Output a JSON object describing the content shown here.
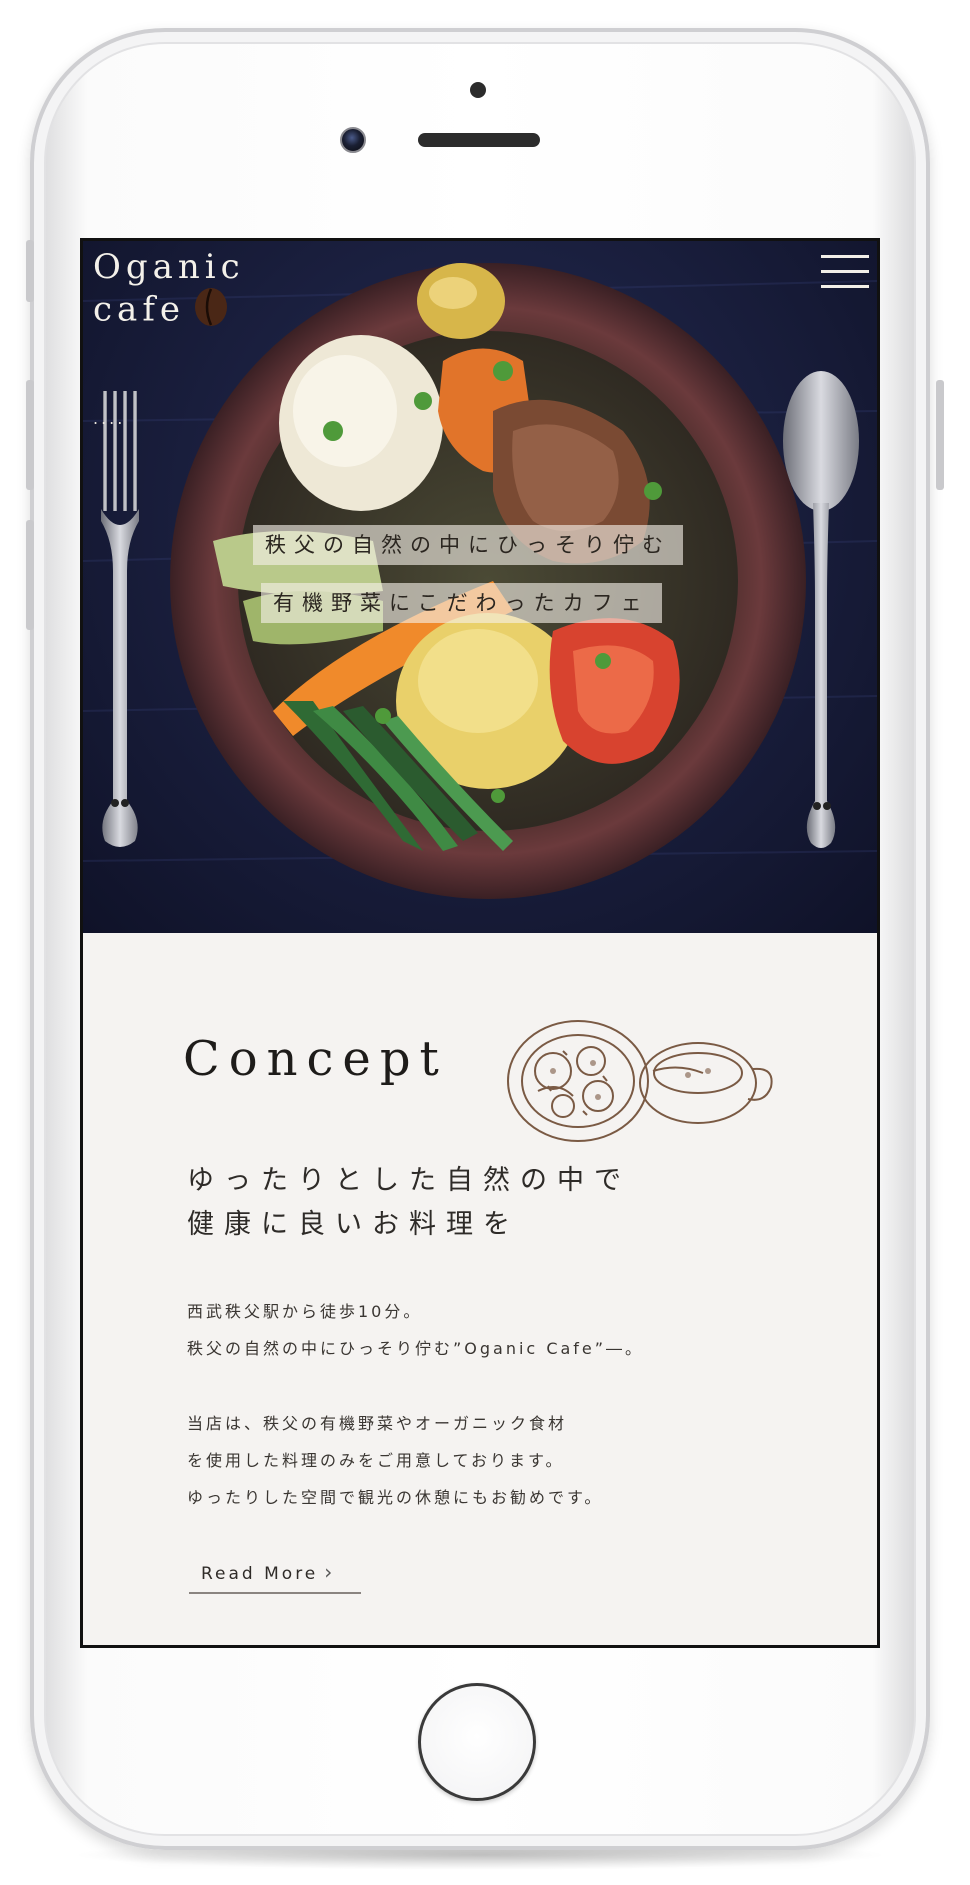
{
  "header": {
    "logo_line1": "Oganic",
    "logo_line2": "cafe",
    "menu_icon": "hamburger-menu-icon",
    "dots": "...."
  },
  "hero": {
    "tagline1": "秩父の自然の中にひっそり佇む",
    "tagline2": "有機野菜にこだわったカフェ"
  },
  "concept": {
    "title": "Concept",
    "lead_line1": "ゆったりとした自然の中で",
    "lead_line2": "健康に良いお料理を",
    "para1_line1": "西武秩父駅から徒歩10分。",
    "para1_line2": "秩父の自然の中にひっそり佇む”Oganic Cafe”―。",
    "para2_line1": "当店は、秩父の有機野菜やオーガニック食材",
    "para2_line2": "を使用した料理のみをご用意しております。",
    "para2_line3": "ゆったりした空間で観光の休憩にもお勧めです。",
    "read_more": "Read More",
    "read_more_icon": "chevron-right-icon"
  },
  "colors": {
    "hero_background": "#1b2040",
    "concept_background": "#f5f3f1",
    "text_dark": "#2e2b28"
  }
}
